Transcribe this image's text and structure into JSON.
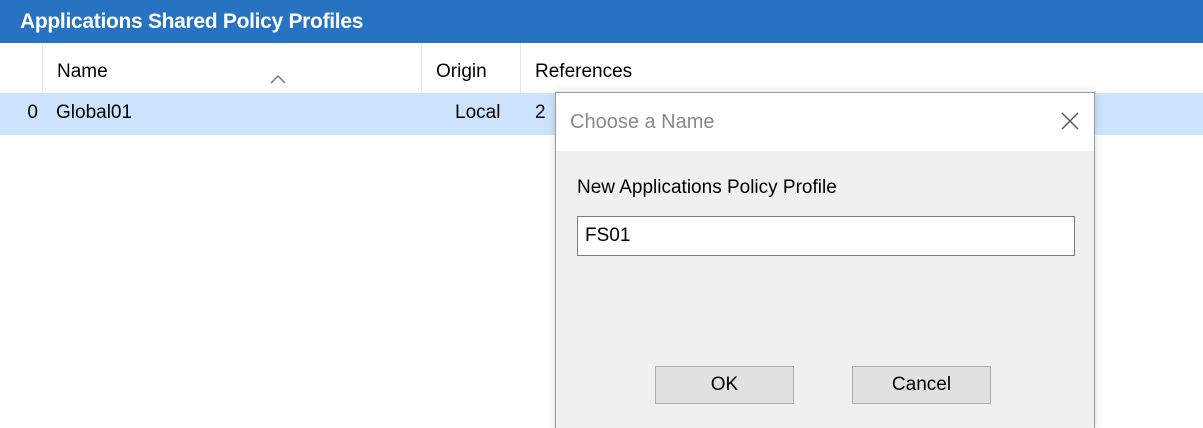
{
  "panel": {
    "title": "Applications Shared Policy Profiles"
  },
  "grid": {
    "columns": {
      "name": "Name",
      "origin": "Origin",
      "references": "References"
    },
    "sort": {
      "column": "name",
      "direction": "ascending",
      "icon": "sort-up-caret-icon"
    },
    "rows": [
      {
        "index": "0",
        "name": "Global01",
        "origin": "Local",
        "references": "2",
        "selected": true
      }
    ]
  },
  "dialog": {
    "title": "Choose a Name",
    "close_icon": "close-icon",
    "label": "New Applications Policy Profile",
    "input_value": "FS01",
    "ok_label": "OK",
    "cancel_label": "Cancel"
  },
  "colors": {
    "title_bar": "#2773c2",
    "row_selected": "#cce4fb",
    "dialog_bg": "#f0f0f0",
    "button_bg": "#e1e1e1"
  }
}
